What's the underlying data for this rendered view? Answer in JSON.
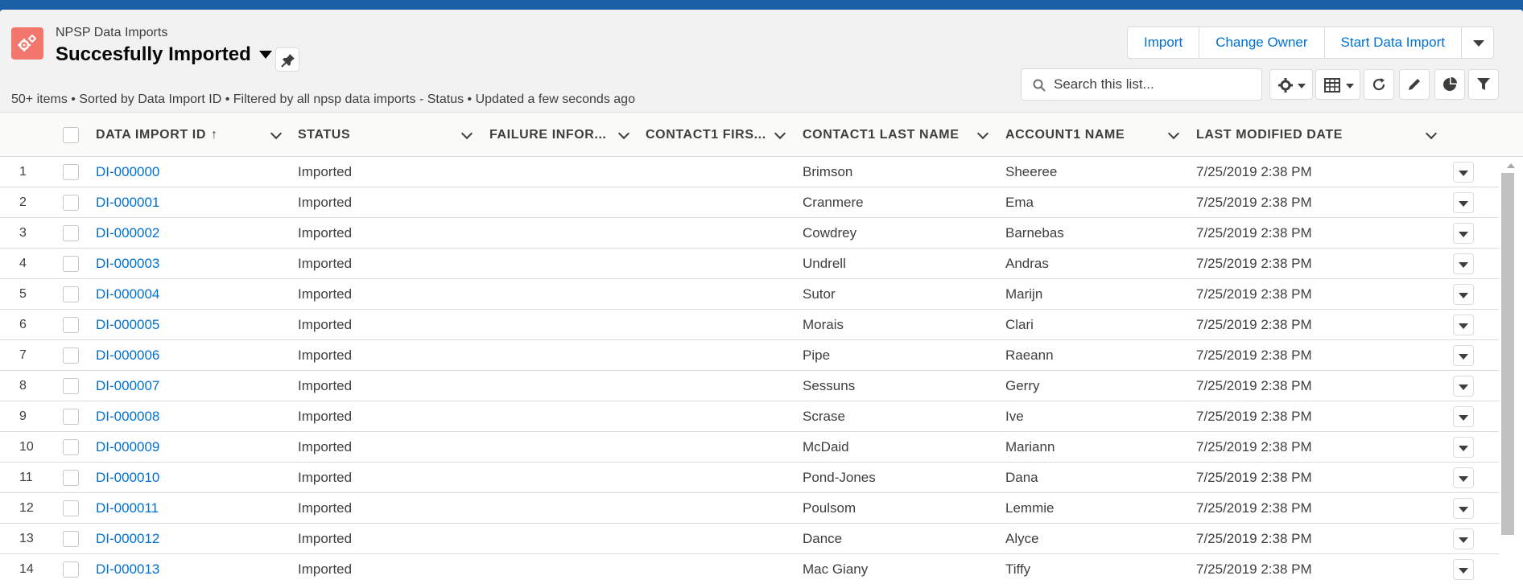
{
  "header": {
    "object_label": "NPSP Data Imports",
    "list_title": "Succesfully Imported",
    "meta": "50+ items • Sorted by Data Import ID • Filtered by all npsp data imports - Status • Updated a few seconds ago",
    "buttons": [
      "Import",
      "Change Owner",
      "Start Data Import"
    ],
    "search_placeholder": "Search this list..."
  },
  "table": {
    "columns": [
      "DATA IMPORT ID",
      "STATUS",
      "FAILURE INFOR...",
      "CONTACT1 FIRS...",
      "CONTACT1 LAST NAME",
      "ACCOUNT1 NAME",
      "LAST MODIFIED DATE"
    ],
    "sort_indicator": "↑",
    "rows": [
      {
        "num": "1",
        "id": "DI-000000",
        "status": "Imported",
        "failure": "",
        "first": "",
        "last": "Brimson",
        "account": "Sheeree",
        "modified": "7/25/2019 2:38 PM"
      },
      {
        "num": "2",
        "id": "DI-000001",
        "status": "Imported",
        "failure": "",
        "first": "",
        "last": "Cranmere",
        "account": "Ema",
        "modified": "7/25/2019 2:38 PM"
      },
      {
        "num": "3",
        "id": "DI-000002",
        "status": "Imported",
        "failure": "",
        "first": "",
        "last": "Cowdrey",
        "account": "Barnebas",
        "modified": "7/25/2019 2:38 PM"
      },
      {
        "num": "4",
        "id": "DI-000003",
        "status": "Imported",
        "failure": "",
        "first": "",
        "last": "Undrell",
        "account": "Andras",
        "modified": "7/25/2019 2:38 PM"
      },
      {
        "num": "5",
        "id": "DI-000004",
        "status": "Imported",
        "failure": "",
        "first": "",
        "last": "Sutor",
        "account": "Marijn",
        "modified": "7/25/2019 2:38 PM"
      },
      {
        "num": "6",
        "id": "DI-000005",
        "status": "Imported",
        "failure": "",
        "first": "",
        "last": "Morais",
        "account": "Clari",
        "modified": "7/25/2019 2:38 PM"
      },
      {
        "num": "7",
        "id": "DI-000006",
        "status": "Imported",
        "failure": "",
        "first": "",
        "last": "Pipe",
        "account": "Raeann",
        "modified": "7/25/2019 2:38 PM"
      },
      {
        "num": "8",
        "id": "DI-000007",
        "status": "Imported",
        "failure": "",
        "first": "",
        "last": "Sessuns",
        "account": "Gerry",
        "modified": "7/25/2019 2:38 PM"
      },
      {
        "num": "9",
        "id": "DI-000008",
        "status": "Imported",
        "failure": "",
        "first": "",
        "last": "Scrase",
        "account": "Ive",
        "modified": "7/25/2019 2:38 PM"
      },
      {
        "num": "10",
        "id": "DI-000009",
        "status": "Imported",
        "failure": "",
        "first": "",
        "last": "McDaid",
        "account": "Mariann",
        "modified": "7/25/2019 2:38 PM"
      },
      {
        "num": "11",
        "id": "DI-000010",
        "status": "Imported",
        "failure": "",
        "first": "",
        "last": "Pond-Jones",
        "account": "Dana",
        "modified": "7/25/2019 2:38 PM"
      },
      {
        "num": "12",
        "id": "DI-000011",
        "status": "Imported",
        "failure": "",
        "first": "",
        "last": "Poulsom",
        "account": "Lemmie",
        "modified": "7/25/2019 2:38 PM"
      },
      {
        "num": "13",
        "id": "DI-000012",
        "status": "Imported",
        "failure": "",
        "first": "",
        "last": "Dance",
        "account": "Alyce",
        "modified": "7/25/2019 2:38 PM"
      },
      {
        "num": "14",
        "id": "DI-000013",
        "status": "Imported",
        "failure": "",
        "first": "",
        "last": "Mac Giany",
        "account": "Tiffy",
        "modified": "7/25/2019 2:38 PM"
      }
    ]
  },
  "colors": {
    "brand_blue": "#1b5fa6",
    "link": "#0070d2",
    "app_icon": "#f2766c",
    "header_bg": "#f3f2f2",
    "border": "#dddbda"
  },
  "icons": [
    "app-gears-icon",
    "pin-icon",
    "search-icon",
    "settings-gear-icon",
    "table-view-icon",
    "refresh-icon",
    "edit-pencil-icon",
    "chart-icon",
    "filter-icon",
    "chevron-down-icon"
  ]
}
